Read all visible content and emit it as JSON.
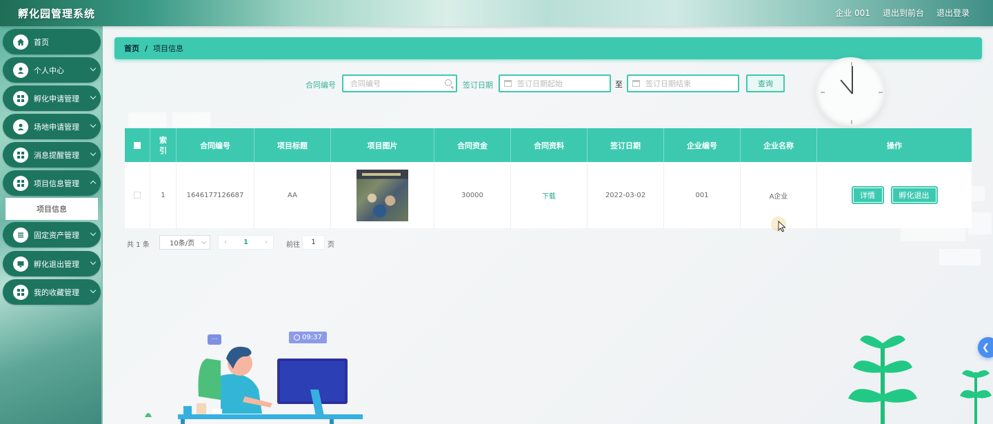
{
  "app": {
    "title": "孵化园管理系统",
    "top_links": [
      "企业 001",
      "退出到前台",
      "退出登录"
    ]
  },
  "sidebar": {
    "items": [
      {
        "label": "首页",
        "icon": "home-icon",
        "expandable": false
      },
      {
        "label": "个人中心",
        "icon": "user-icon",
        "expandable": true
      },
      {
        "label": "孵化申请管理",
        "icon": "grid-icon",
        "expandable": true
      },
      {
        "label": "场地申请管理",
        "icon": "user-icon",
        "expandable": true
      },
      {
        "label": "消息提醒管理",
        "icon": "grid-icon",
        "expandable": true
      },
      {
        "label": "项目信息管理",
        "icon": "grid-icon",
        "expandable": true
      },
      {
        "label": "固定资产管理",
        "icon": "list-icon",
        "expandable": true
      },
      {
        "label": "孵化退出管理",
        "icon": "monitor-icon",
        "expandable": true
      },
      {
        "label": "我的收藏管理",
        "icon": "grid-icon",
        "expandable": true
      }
    ],
    "active_sub": "项目信息"
  },
  "breadcrumb": {
    "home": "首页",
    "sep": "/",
    "current": "项目信息"
  },
  "search": {
    "contract_label": "合同编号",
    "contract_placeholder": "合同编号",
    "date_label": "签订日期",
    "date_start_placeholder": "签订日期起始",
    "to_label": "至",
    "date_end_placeholder": "签订日期结束",
    "query_button": "查询"
  },
  "table": {
    "headers": [
      "索引",
      "合同编号",
      "项目标题",
      "项目图片",
      "合同资金",
      "合同资料",
      "签订日期",
      "企业编号",
      "企业名称",
      "操作"
    ],
    "rows": [
      {
        "index": "1",
        "contract_no": "1646177126687",
        "title": "AA",
        "fund": "30000",
        "material": "下载",
        "sign_date": "2022-03-02",
        "company_no": "001",
        "company_name": "A企业",
        "actions": [
          "详情",
          "孵化退出"
        ]
      }
    ]
  },
  "pagination": {
    "total_text": "共 1 条",
    "page_size": "10条/页",
    "current_page": "1",
    "goto_label": "前往",
    "goto_value": "1",
    "page_suffix": "页"
  },
  "illustration": {
    "time": "09:37",
    "chat": "..."
  },
  "colors": {
    "accent": "#3cc9b0",
    "sidebar_item": "#1d7560",
    "handle": "#4a8ef0"
  }
}
